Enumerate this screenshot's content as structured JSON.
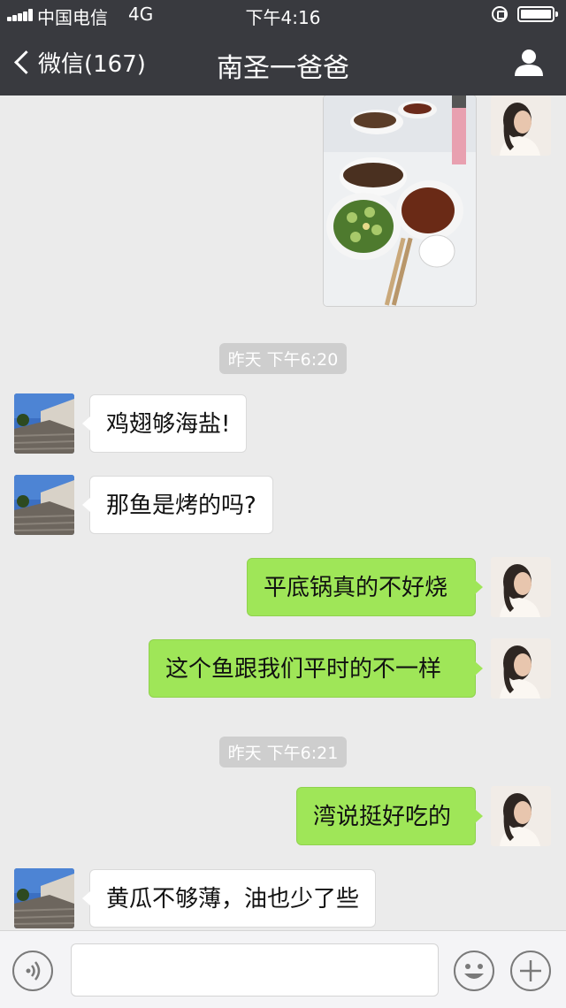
{
  "status_bar": {
    "carrier": "中国电信",
    "network": "4G",
    "time": "下午4:16"
  },
  "nav": {
    "back_label": "微信(167)",
    "title": "南圣一爸爸"
  },
  "messages": {
    "ts1": "昨天 下午6:20",
    "m1": "鸡翅够海盐!",
    "m2": "那鱼是烤的吗?",
    "m3": "平底锅真的不好烧",
    "m4": "这个鱼跟我们平时的不一样",
    "ts2": "昨天 下午6:21",
    "m5": "湾说挺好吃的",
    "m6": "黄瓜不够薄，油也少了些"
  },
  "colors": {
    "nav_bg": "#393a3f",
    "chat_bg": "#ebebeb",
    "outgoing_bubble": "#9fe658",
    "incoming_bubble": "#ffffff"
  },
  "icons": {
    "voice": "voice-icon",
    "emoji": "emoji-icon",
    "plus": "plus-icon",
    "profile": "person-icon"
  }
}
